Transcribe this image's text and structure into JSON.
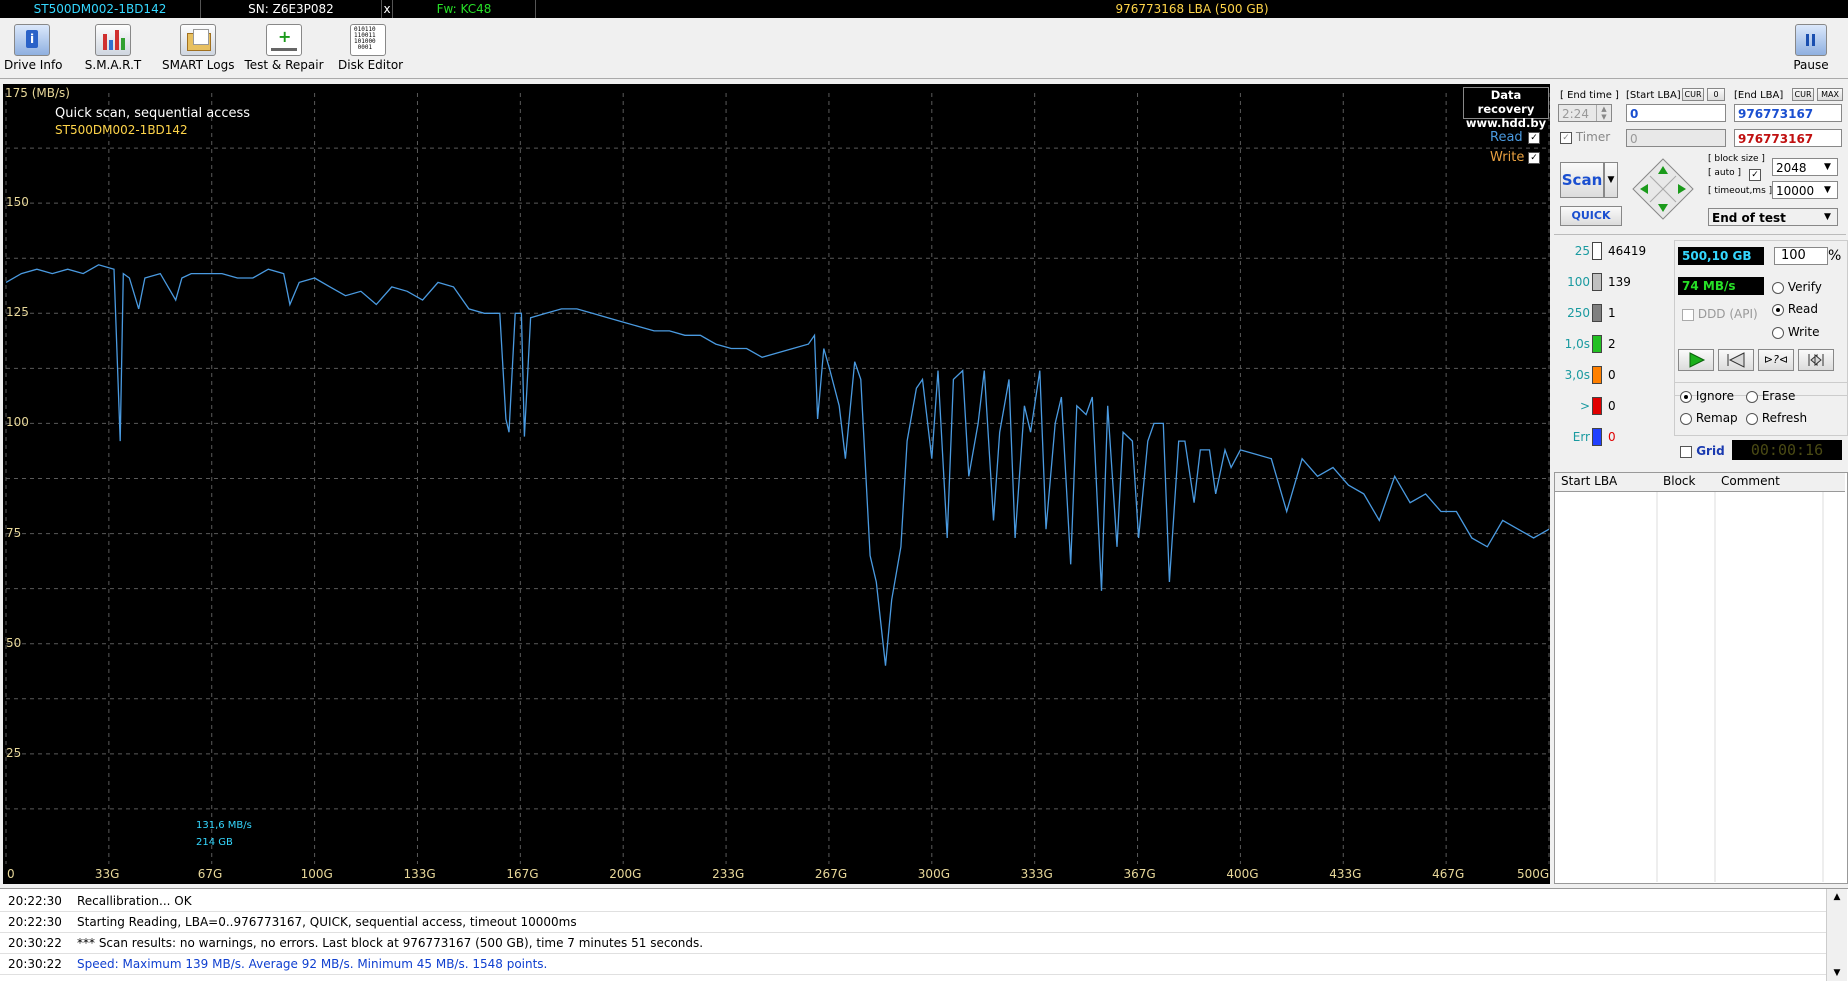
{
  "status_bar": {
    "model": "ST500DM002-1BD142",
    "serial": "SN: Z6E3P082",
    "close": "x",
    "firmware": "Fw: KC48",
    "capacity": "976773168 LBA (500 GB)"
  },
  "toolbar": {
    "drive_info": "Drive Info",
    "smart": "S.M.A.R.T",
    "smart_logs": "SMART Logs",
    "test_repair": "Test & Repair",
    "disk_editor": "Disk Editor",
    "disk_editor_glyph": "010110\n110011\n101000\n0001",
    "pause": "Pause"
  },
  "graph": {
    "y_unit_label": "175 (MB/s)",
    "title": "Quick scan, sequential access",
    "subtitle": "ST500DM002-1BD142",
    "brand_line1": "Data recovery",
    "brand_line2": "www.hdd.by",
    "legend_read": "Read",
    "legend_write": "Write",
    "legend_check": "✓",
    "cursor_speed": "131,6 MB/s",
    "cursor_pos": "214 GB",
    "colors": {
      "line": "#4a9ae0",
      "grid": "#5a5a5a",
      "tick": "#e8d89a",
      "title": "#ffffff",
      "subtitle": "#ffd54a",
      "read": "#4a9ae0",
      "write": "#e8a040"
    }
  },
  "chart_data": {
    "type": "line",
    "title": "Quick scan, sequential access",
    "xlabel": "",
    "ylabel": "(MB/s)",
    "x_ticks": [
      "0",
      "33G",
      "67G",
      "100G",
      "133G",
      "167G",
      "200G",
      "233G",
      "267G",
      "300G",
      "333G",
      "367G",
      "400G",
      "433G",
      "467G",
      "500G"
    ],
    "y_ticks": [
      "25",
      "50",
      "75",
      "100",
      "125",
      "150",
      "175"
    ],
    "xlim": [
      0,
      500
    ],
    "ylim": [
      0,
      175
    ],
    "grid": true,
    "series": [
      {
        "name": "Read",
        "x": [
          0,
          5,
          10,
          15,
          20,
          25,
          30,
          35,
          37,
          38,
          40,
          43,
          45,
          50,
          55,
          57,
          60,
          65,
          70,
          75,
          80,
          85,
          90,
          92,
          95,
          100,
          105,
          110,
          115,
          120,
          125,
          130,
          135,
          140,
          145,
          150,
          155,
          160,
          162,
          163,
          165,
          167,
          168,
          170,
          175,
          180,
          185,
          190,
          195,
          200,
          205,
          210,
          215,
          220,
          225,
          230,
          235,
          240,
          245,
          250,
          255,
          260,
          262,
          263,
          265,
          267,
          270,
          272,
          275,
          277,
          280,
          282,
          285,
          287,
          290,
          292,
          295,
          297,
          300,
          302,
          305,
          307,
          310,
          312,
          315,
          317,
          320,
          322,
          325,
          327,
          330,
          332,
          335,
          337,
          340,
          342,
          345,
          347,
          350,
          352,
          355,
          357,
          360,
          362,
          365,
          367,
          370,
          372,
          375,
          377,
          380,
          382,
          385,
          387,
          390,
          392,
          395,
          397,
          400,
          405,
          410,
          415,
          420,
          425,
          430,
          435,
          440,
          445,
          450,
          455,
          460,
          465,
          470,
          475,
          480,
          485,
          490,
          495,
          500
        ],
        "values": [
          132,
          134,
          135,
          134,
          135,
          134,
          136,
          135,
          96,
          134,
          133,
          126,
          133,
          134,
          128,
          133,
          134,
          134,
          134,
          133,
          133,
          135,
          134,
          127,
          132,
          133,
          131,
          129,
          130,
          127,
          131,
          130,
          128,
          132,
          131,
          126,
          125,
          125,
          101,
          98,
          125,
          125,
          97,
          124,
          125,
          126,
          126,
          125,
          124,
          123,
          122,
          121,
          121,
          120,
          120,
          118,
          117,
          117,
          115,
          116,
          117,
          118,
          120,
          101,
          117,
          112,
          104,
          92,
          114,
          110,
          70,
          64,
          45,
          60,
          72,
          96,
          108,
          110,
          92,
          112,
          74,
          110,
          112,
          88,
          100,
          112,
          78,
          98,
          110,
          74,
          104,
          98,
          112,
          76,
          100,
          106,
          68,
          104,
          102,
          106,
          62,
          104,
          72,
          98,
          96,
          74,
          96,
          100,
          100,
          64,
          96,
          96,
          82,
          94,
          94,
          84,
          94,
          90,
          94,
          93,
          92,
          80,
          92,
          88,
          90,
          86,
          84,
          78,
          88,
          82,
          84,
          80,
          80,
          74,
          72,
          78,
          76,
          74,
          76
        ]
      }
    ]
  },
  "right_panel": {
    "end_time_label": "[ End time ]",
    "end_time_value": "2:24",
    "start_lba_label": "[Start LBA]",
    "cur_label": "CUR",
    "zero_label": "0",
    "end_lba_label": "[End LBA]",
    "cur2_label": "CUR",
    "max_label": "MAX",
    "start_lba_value": "0",
    "end_lba_value": "976773167",
    "timer_label": "Timer",
    "timer_value": "0",
    "end_lba_value2": "976773167",
    "scan_button": "Scan",
    "quick_button": "QUICK",
    "block_size_label": "[ block size ]",
    "auto_label": "[ auto ]",
    "timeout_label": "[ timeout,ms ]",
    "block_size_value": "2048",
    "timeout_value": "10000",
    "end_action": "End of test",
    "counters": [
      {
        "label": "25",
        "count": "46419",
        "color": "#ffffff"
      },
      {
        "label": "100",
        "count": "139",
        "color": "#c0c0c0"
      },
      {
        "label": "250",
        "count": "1",
        "color": "#808080"
      },
      {
        "label": "1,0s",
        "count": "2",
        "color": "#22c022"
      },
      {
        "label": "3,0s",
        "count": "0",
        "color": "#ff8000"
      },
      {
        "label": ">",
        "count": "0",
        "color": "#e00000"
      },
      {
        "label": "Err",
        "count": "0",
        "color": "#2040ff"
      }
    ],
    "size_value": "500,10 GB",
    "percent_value": "100",
    "percent_sign": "%",
    "speed_value": "74 MB/s",
    "ddd_label": "DDD (API)",
    "verify_label": "Verify",
    "read_label": "Read",
    "write_label": "Write",
    "ignore_label": "Ignore",
    "erase_label": "Erase",
    "remap_label": "Remap",
    "refresh_label": "Refresh",
    "grid_label": "Grid",
    "timer_display": "00:00:16",
    "table_headers": [
      "Start LBA",
      "Block",
      "Comment"
    ]
  },
  "log": [
    {
      "time": "20:22:30",
      "msg": "Recallibration... OK",
      "color": "#000000"
    },
    {
      "time": "20:22:30",
      "msg": "Starting Reading, LBA=0..976773167, QUICK, sequential access, timeout 10000ms",
      "color": "#000000"
    },
    {
      "time": "20:30:22",
      "msg": "*** Scan results: no warnings, no errors. Last block at 976773167 (500 GB), time 7 minutes 51 seconds.",
      "color": "#000000"
    },
    {
      "time": "20:30:22",
      "msg": "Speed: Maximum 139 MB/s. Average 92 MB/s. Minimum 45 MB/s. 1548 points.",
      "color": "#1040d0"
    }
  ]
}
